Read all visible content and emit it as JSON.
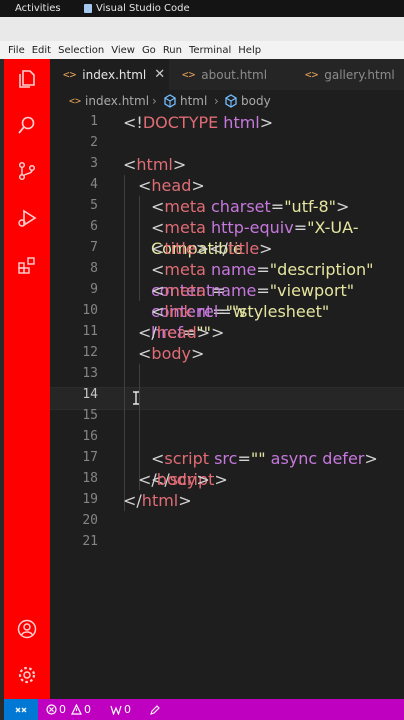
{
  "system": {
    "activities": "Activities",
    "app_name": "Visual Studio Code"
  },
  "menu": [
    "File",
    "Edit",
    "Selection",
    "View",
    "Go",
    "Run",
    "Terminal",
    "Help"
  ],
  "tabs": [
    {
      "label": "index.html",
      "active": true
    },
    {
      "label": "about.html",
      "active": false
    },
    {
      "label": "gallery.html",
      "active": false
    }
  ],
  "breadcrumb": [
    "index.html",
    "html",
    "body"
  ],
  "line_numbers": [
    "1",
    "2",
    "3",
    "4",
    "5",
    "6",
    "7",
    "8",
    "9",
    "10",
    "11",
    "12",
    "13",
    "14",
    "15",
    "16",
    "17",
    "18",
    "19",
    "20",
    "21"
  ],
  "current_line": "14",
  "code": {
    "l1": {
      "open": "<!",
      "kw": "DOCTYPE",
      "rest": " html",
      "close": ">"
    },
    "l3": {
      "open": "<",
      "tag": "html",
      "close": ">"
    },
    "l4": {
      "open": "<",
      "tag": "head",
      "close": ">"
    },
    "l5": {
      "open": "<",
      "tag": "meta",
      "attr": " charset",
      "eq": "=",
      "val": "\"utf-8\"",
      "close": ">"
    },
    "l6": {
      "open": "<",
      "tag": "meta",
      "attr": " http-equiv",
      "eq": "=",
      "val": "\"X-UA-Compatible"
    },
    "l7": {
      "open": "<",
      "tag": "title",
      "mid": "></",
      "tag2": "title",
      "close": ">"
    },
    "l8": {
      "open": "<",
      "tag": "meta",
      "attr": " name",
      "eq": "=",
      "val": "\"description\"",
      "attr2": " content",
      "eq2": "="
    },
    "l9": {
      "open": "<",
      "tag": "meta",
      "attr": " name",
      "eq": "=",
      "val": "\"viewport\"",
      "attr2": " content",
      "eq2": "=",
      "val2": "\"w"
    },
    "l10": {
      "open": "<",
      "tag": "link",
      "attr": " rel",
      "eq": "=",
      "val": "\"stylesheet\"",
      "attr2": " href",
      "eq2": "=",
      "val2": "\"\"",
      "close": ">"
    },
    "l11": {
      "open": "</",
      "tag": "head",
      "close": ">"
    },
    "l12": {
      "open": "<",
      "tag": "body",
      "close": ">"
    },
    "l17": {
      "open": "<",
      "tag": "script",
      "attr": " src",
      "eq": "=",
      "val": "\"\"",
      "attr2": " async",
      "attr3": " defer",
      "mid": "></",
      "tag2": "script",
      "close": ">"
    },
    "l18": {
      "open": "</",
      "tag": "body",
      "close": ">"
    },
    "l19": {
      "open": "</",
      "tag": "html",
      "close": ">"
    }
  },
  "status": {
    "errors": "0",
    "warnings": "0",
    "ports": "0"
  },
  "colors": {
    "activity_bar": "#ff0000",
    "status_bar": "#c000c0",
    "remote": "#0078d4"
  }
}
